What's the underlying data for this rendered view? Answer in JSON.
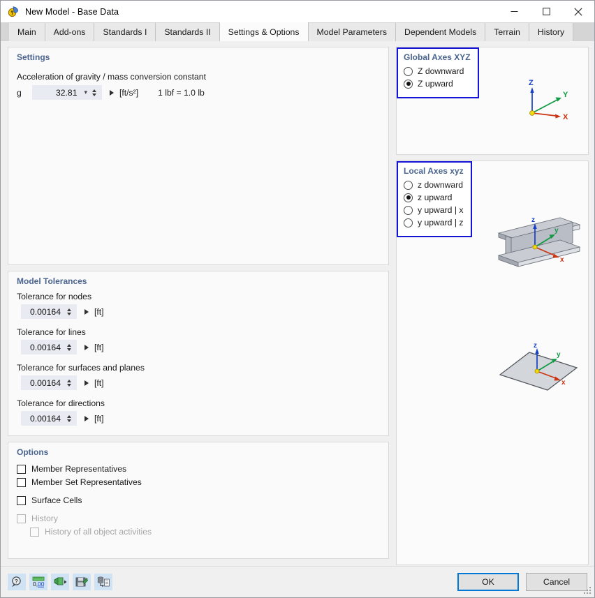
{
  "window": {
    "title": "New Model - Base Data",
    "app_icon": "model-icon",
    "minimize": "–",
    "maximize": "☐",
    "close": "✕"
  },
  "tabs": [
    {
      "label": "Main",
      "active": false
    },
    {
      "label": "Add-ons",
      "active": false
    },
    {
      "label": "Standards I",
      "active": false
    },
    {
      "label": "Standards II",
      "active": false
    },
    {
      "label": "Settings & Options",
      "active": true
    },
    {
      "label": "Model Parameters",
      "active": false
    },
    {
      "label": "Dependent Models",
      "active": false
    },
    {
      "label": "Terrain",
      "active": false
    },
    {
      "label": "History",
      "active": false
    }
  ],
  "settings": {
    "title": "Settings",
    "gravity_caption": "Acceleration of gravity / mass conversion constant",
    "gravity_symbol": "g",
    "gravity_value": "32.81",
    "gravity_unit": "[ft/s²]",
    "conversion_note": "1 lbf = 1.0 lb"
  },
  "tolerances": {
    "title": "Model Tolerances",
    "items": [
      {
        "label": "Tolerance for nodes",
        "value": "0.00164",
        "unit": "[ft]"
      },
      {
        "label": "Tolerance for lines",
        "value": "0.00164",
        "unit": "[ft]"
      },
      {
        "label": "Tolerance for surfaces and planes",
        "value": "0.00164",
        "unit": "[ft]"
      },
      {
        "label": "Tolerance for directions",
        "value": "0.00164",
        "unit": "[ft]"
      }
    ]
  },
  "options": {
    "title": "Options",
    "items": [
      {
        "label": "Member Representatives",
        "checked": false,
        "disabled": false,
        "indent": false,
        "gap_top": false
      },
      {
        "label": "Member Set Representatives",
        "checked": false,
        "disabled": false,
        "indent": false,
        "gap_top": false
      },
      {
        "label": "Surface Cells",
        "checked": false,
        "disabled": false,
        "indent": false,
        "gap_top": true
      },
      {
        "label": "History",
        "checked": false,
        "disabled": true,
        "indent": false,
        "gap_top": true
      },
      {
        "label": "History of all object activities",
        "checked": false,
        "disabled": true,
        "indent": true,
        "gap_top": false
      }
    ]
  },
  "global_axes": {
    "title": "Global Axes XYZ",
    "options": [
      {
        "label": "Z downward",
        "selected": false
      },
      {
        "label": "Z upward",
        "selected": true
      }
    ],
    "graphic_labels": {
      "z": "Z",
      "y": "Y",
      "x": "X"
    }
  },
  "local_axes": {
    "title": "Local Axes xyz",
    "options": [
      {
        "label": "z downward",
        "selected": false
      },
      {
        "label": "z upward",
        "selected": true
      },
      {
        "label": "y upward | x",
        "selected": false
      },
      {
        "label": "y upward | z",
        "selected": false
      }
    ],
    "beam_labels": {
      "z": "z",
      "y": "y",
      "x": "x"
    },
    "surface_labels": {
      "z": "z",
      "y": "y",
      "x": "x"
    }
  },
  "footer": {
    "tools": [
      {
        "name": "help-search-icon",
        "glyph": "?"
      },
      {
        "name": "units-ruler-icon",
        "glyph": "0,00"
      },
      {
        "name": "import-settings-icon",
        "glyph": ""
      },
      {
        "name": "save-settings-icon",
        "glyph": ""
      },
      {
        "name": "copy-to-clipboard-icon",
        "glyph": ""
      }
    ],
    "ok_label": "OK",
    "cancel_label": "Cancel"
  },
  "colors": {
    "accent_blue": "#1414d6",
    "focus_blue": "#0078d7",
    "panel_title": "#4a6490",
    "axis_x": "#cc3311",
    "axis_y": "#119944",
    "axis_z": "#1540c8",
    "origin": "#f5d90a"
  }
}
